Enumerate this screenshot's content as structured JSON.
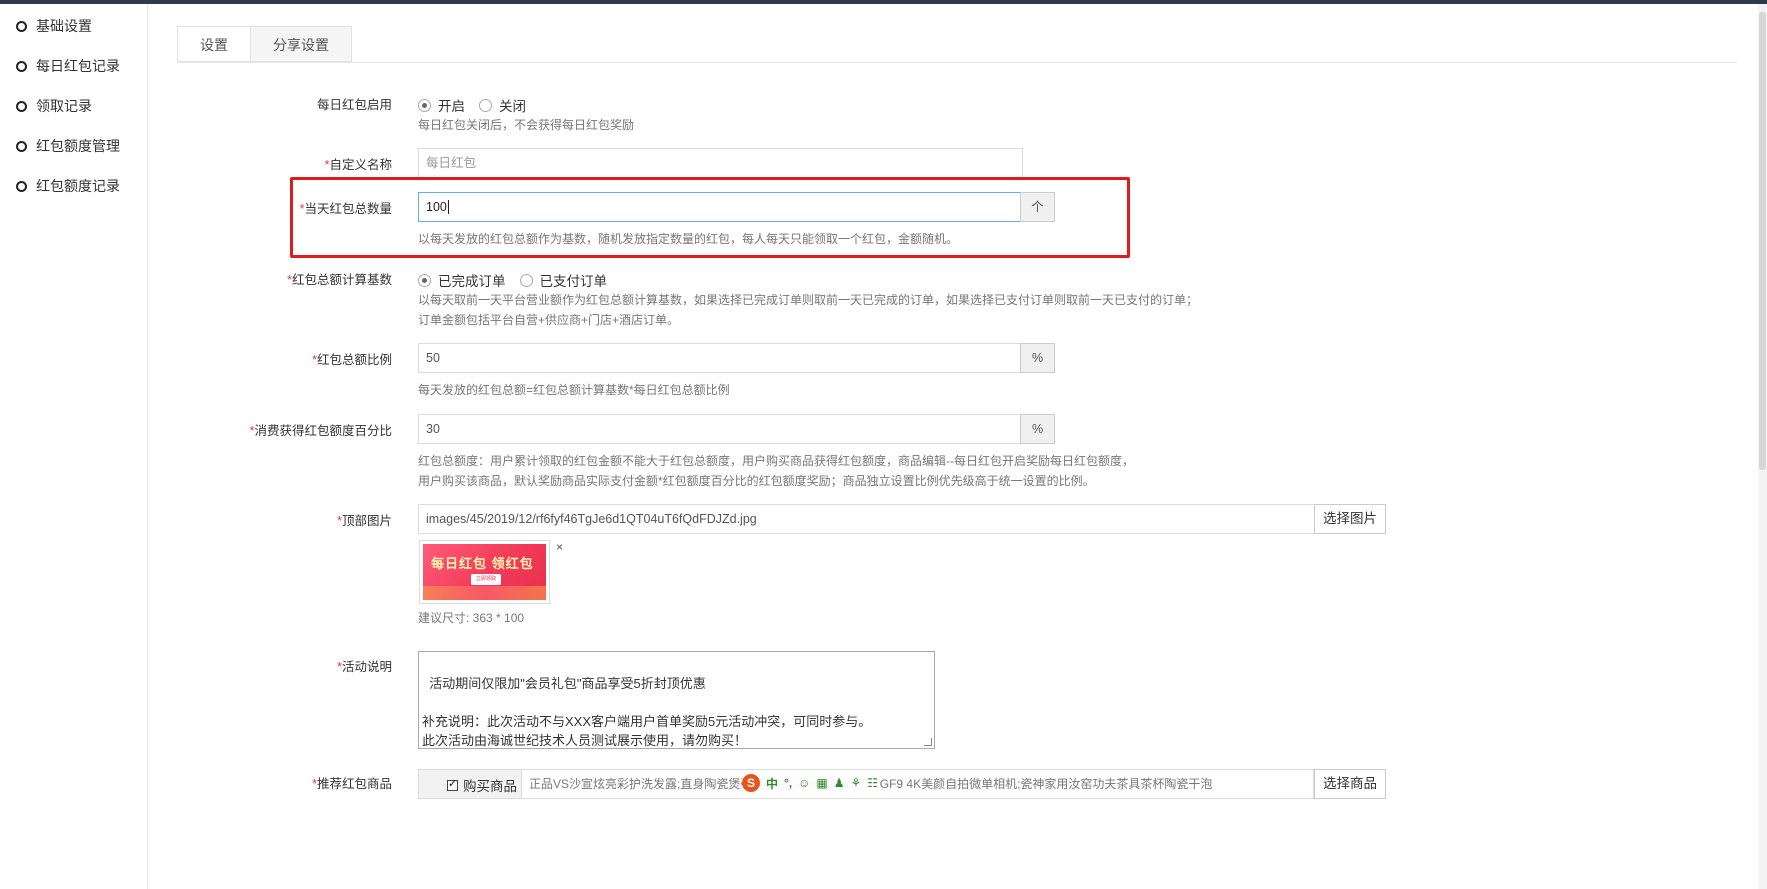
{
  "sidebar": {
    "items": [
      {
        "label": "基础设置"
      },
      {
        "label": "每日红包记录"
      },
      {
        "label": "领取记录"
      },
      {
        "label": "红包额度管理"
      },
      {
        "label": "红包额度记录"
      }
    ]
  },
  "tabs": [
    {
      "label": "设置"
    },
    {
      "label": "分享设置"
    }
  ],
  "form": {
    "enable": {
      "label": "每日红包启用",
      "options": [
        "开启",
        "关闭"
      ],
      "selected": "开启",
      "help": "每日红包关闭后，不会获得每日红包奖励"
    },
    "custom_name": {
      "label": "自定义名称",
      "required": "*",
      "placeholder": "每日红包"
    },
    "total_count": {
      "label": "当天红包总数量",
      "required": "*",
      "value": "100",
      "addon": "个",
      "help": "以每天发放的红包总额作为基数，随机发放指定数量的红包，每人每天只能领取一个红包，金额随机。"
    },
    "calc_base": {
      "label": "红包总额计算基数",
      "required": "*",
      "options": [
        "已完成订单",
        "已支付订单"
      ],
      "selected": "已完成订单",
      "help1": "以每天取前一天平台营业额作为红包总额计算基数，如果选择已完成订单则取前一天已完成的订单，如果选择已支付订单则取前一天已支付的订单；",
      "help2": "订单金额包括平台自营+供应商+门店+酒店订单。"
    },
    "ratio": {
      "label": "红包总额比例",
      "required": "*",
      "value": "50",
      "addon": "%",
      "help": "每天发放的红包总额=红包总额计算基数*每日红包总额比例"
    },
    "consume_percent": {
      "label": "消费获得红包额度百分比",
      "required": "*",
      "value": "30",
      "addon": "%",
      "help1": "红包总额度：用户累计领取的红包金额不能大于红包总额度，用户购买商品获得红包额度，商品编辑--每日红包开启奖励每日红包额度，",
      "help2": "用户购买该商品，默认奖励商品实际支付金额*红包额度百分比的红包额度奖励；商品独立设置比例优先级高于统一设置的比例。"
    },
    "top_image": {
      "label": "顶部图片",
      "required": "*",
      "value": "images/45/2019/12/rf6fyf46TgJe6d1QT04uT6fQdFDJZd.jpg",
      "button": "选择图片",
      "thumb_text": "每日红包  领红包",
      "thumb_button": "立即领取",
      "close": "×",
      "help": "建议尺寸: 363 * 100"
    },
    "activity_desc": {
      "label": "活动说明",
      "required": "*",
      "value": "活动期间仅限加\"会员礼包\"商品享受5折封顶优惠\n\n补充说明：此次活动不与XXX客户端用户首单奖励5元活动冲突，可同时参与。\n此次活动由海诚世纪技术人员测试展示使用，请勿购买！"
    },
    "recommend_goods": {
      "label": "推荐红包商品",
      "required": "*",
      "checkbox_label": "购买商品",
      "value": "正品VS沙宣炫亮彩护洗发露;直身陶瓷煲砂锅                                        20寸;Panasonic松下 GF9 4K美颜自拍微单相机;瓷神家用汝窑功夫茶具茶杯陶瓷干泡",
      "button": "选择商品"
    }
  },
  "ime": {
    "logo": "S",
    "items": [
      "中",
      "°,",
      "☺",
      "▦",
      "♟",
      "⚘",
      "☷"
    ]
  },
  "colors": {
    "highlight": "#e01b1b",
    "required": "#e4393c",
    "focus_border": "#66afe9"
  }
}
